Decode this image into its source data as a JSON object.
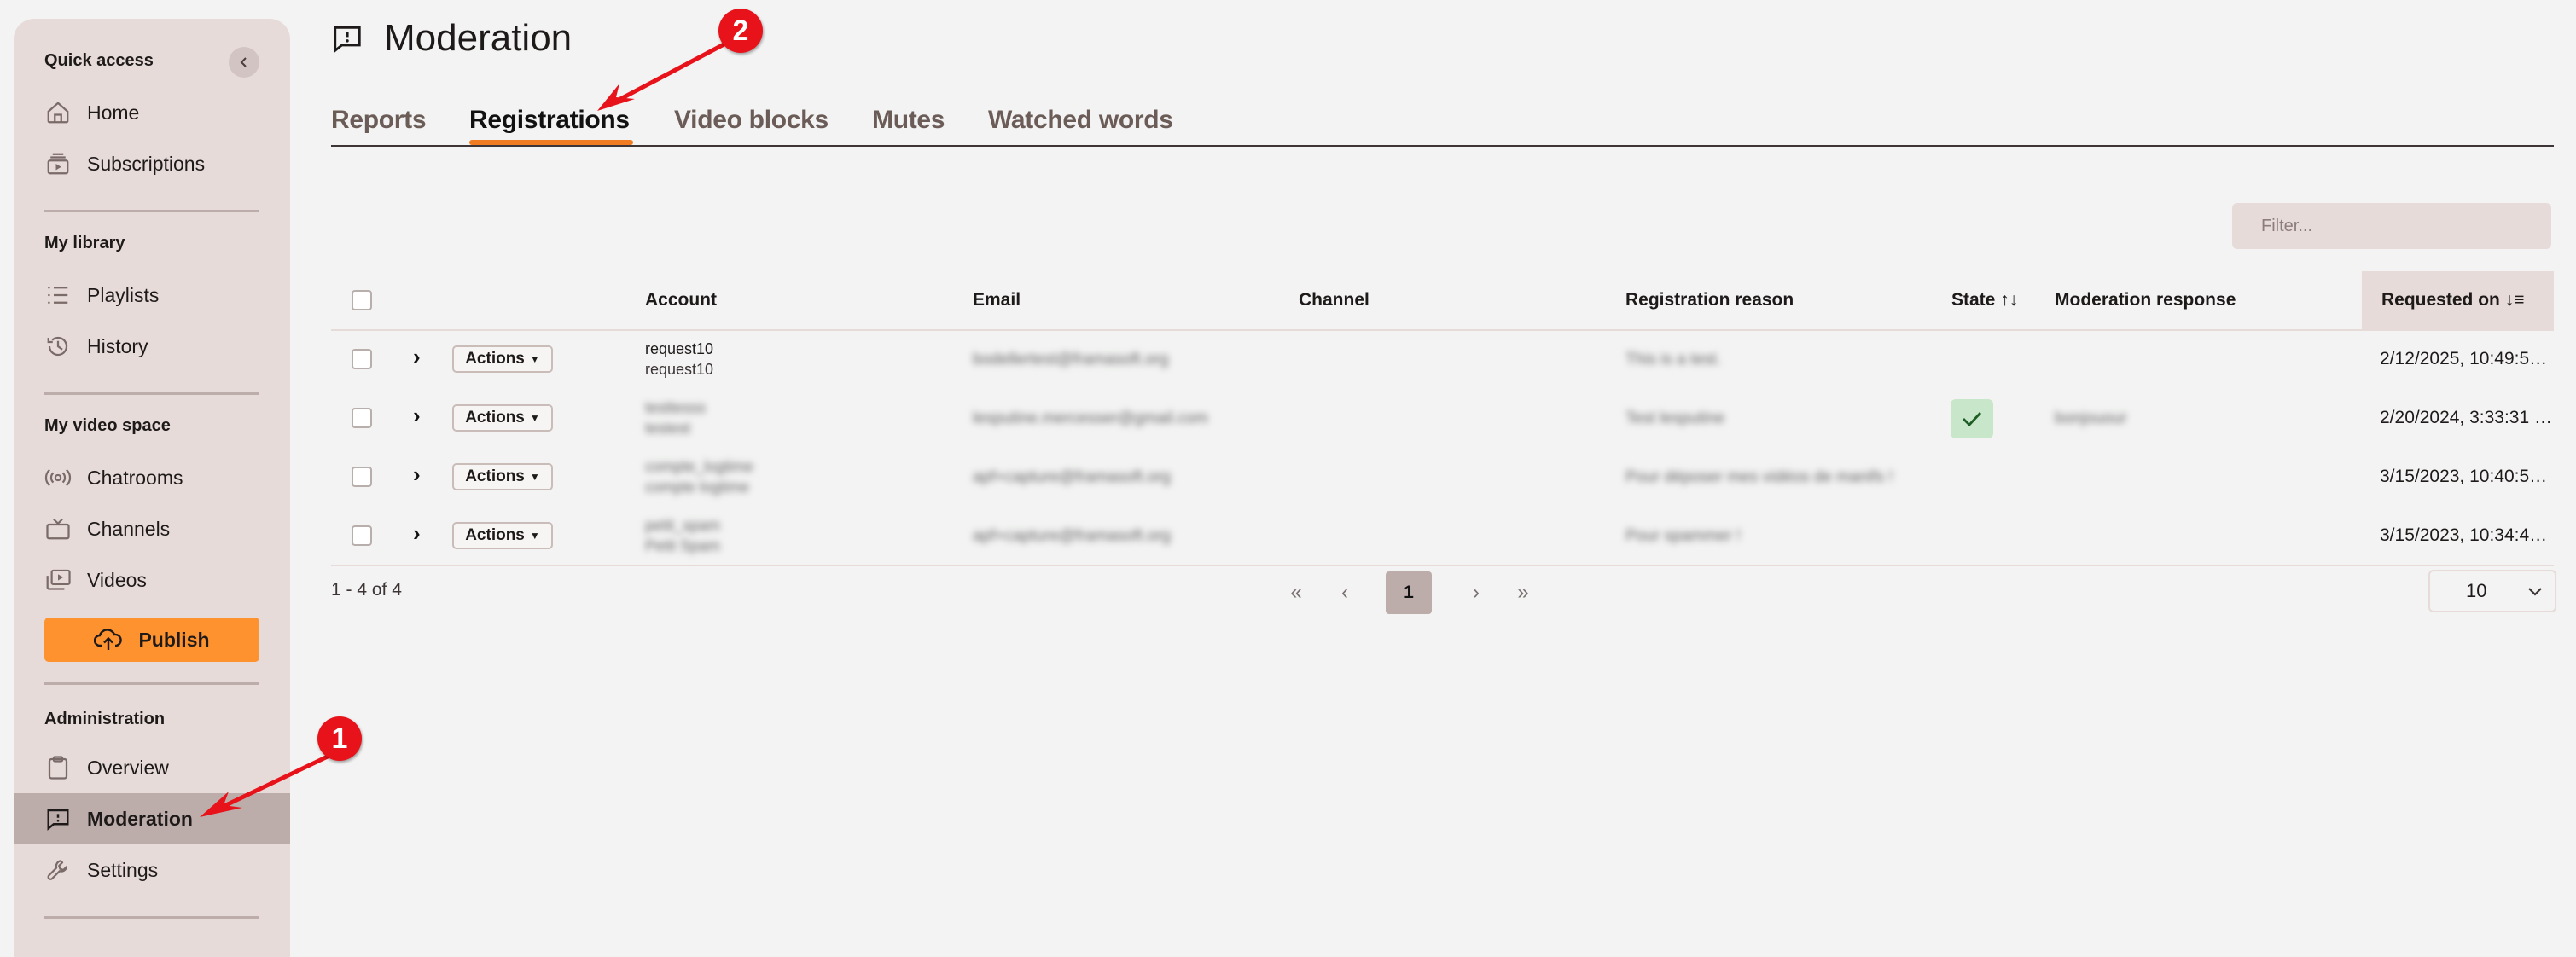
{
  "sidebar": {
    "collapse_icon": "chevron-left-icon",
    "sections": [
      {
        "title": "Quick access",
        "items": [
          {
            "label": "Home",
            "icon": "home-icon"
          },
          {
            "label": "Subscriptions",
            "icon": "subscriptions-icon"
          }
        ]
      },
      {
        "title": "My library",
        "items": [
          {
            "label": "Playlists",
            "icon": "playlists-icon"
          },
          {
            "label": "History",
            "icon": "history-icon"
          }
        ]
      },
      {
        "title": "My video space",
        "items": [
          {
            "label": "Chatrooms",
            "icon": "broadcast-icon"
          },
          {
            "label": "Channels",
            "icon": "tv-icon"
          },
          {
            "label": "Videos",
            "icon": "videos-icon"
          }
        ]
      },
      {
        "title": "Administration",
        "items": [
          {
            "label": "Overview",
            "icon": "clipboard-icon"
          },
          {
            "label": "Moderation",
            "icon": "moderation-icon",
            "active": true
          },
          {
            "label": "Settings",
            "icon": "wrench-icon"
          }
        ]
      }
    ],
    "publish_label": "Publish"
  },
  "header": {
    "title": "Moderation",
    "icon": "moderation-icon"
  },
  "tabs": [
    {
      "label": "Reports"
    },
    {
      "label": "Registrations",
      "active": true
    },
    {
      "label": "Video blocks"
    },
    {
      "label": "Mutes"
    },
    {
      "label": "Watched words"
    }
  ],
  "filter": {
    "placeholder": "Filter...",
    "value": ""
  },
  "table": {
    "columns": [
      "Account",
      "Email",
      "Channel",
      "Registration reason",
      "State",
      "Moderation response",
      "Requested on"
    ],
    "sorted_column": "Requested on",
    "sort_direction": "descending",
    "actions_label": "Actions",
    "rows": [
      {
        "account": "request10",
        "account_sub": "request10",
        "email": "bodellertest@framasoft.org",
        "channel": "",
        "reason": "This is a test.",
        "state": "",
        "response": "",
        "requested_on": "2/12/2025, 10:49:5…",
        "blurred": false
      },
      {
        "account": "testtesss",
        "account_sub": "testest",
        "email": "lesputine.mercesser@gmail.com",
        "channel": "",
        "reason": "Test lesputine",
        "state": "accepted",
        "response": "bonjouour",
        "requested_on": "2/20/2024, 3:33:31 …",
        "blurred": true
      },
      {
        "account": "compte_logtime",
        "account_sub": "compte logtime",
        "email": "apf+capture@framasoft.org",
        "channel": "",
        "reason": "Pour déposer mes vidéos de manifs !",
        "state": "",
        "response": "",
        "requested_on": "3/15/2023, 10:40:5…",
        "blurred": true
      },
      {
        "account": "petit_spam",
        "account_sub": "Petit Spam",
        "email": "apf+capture@framasoft.org",
        "channel": "",
        "reason": "Pour spammer !",
        "state": "",
        "response": "",
        "requested_on": "3/15/2023, 10:34:4…",
        "blurred": true
      }
    ]
  },
  "pagination": {
    "range_text": "1 - 4 of 4",
    "current_page": "1",
    "per_page": "10"
  },
  "annotations": [
    {
      "number": "1",
      "target": "Moderation"
    },
    {
      "number": "2",
      "target": "Registrations"
    }
  ],
  "colors": {
    "accent": "#fe922f",
    "tab_underline": "#f07b21",
    "sidebar_bg": "#e6dbd9",
    "active_item": "#bcadaa",
    "annotation": "#e8121a",
    "success_bg": "#c8e6c9"
  }
}
